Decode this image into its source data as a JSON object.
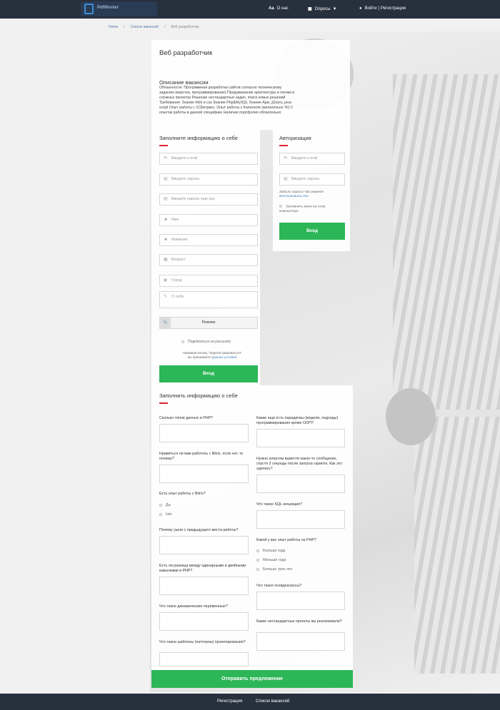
{
  "header": {
    "logo_text": "PdfWorker",
    "about": "О нас",
    "polls": "Опросы",
    "login": "Войти",
    "separator": "|",
    "register": "Регистрация"
  },
  "breadcrumbs": [
    "Home",
    "Список вакансий",
    "Веб разработчик"
  ],
  "vacancy": {
    "title": "Веб разработчик",
    "desc_heading": "Описание вакансии",
    "desc_text": "Обязанности: Программная разработка сайтов согласно техническому заданию (верстка, программирование) Продумывание архитектуры и логики в сложных проектах Решение нестандартных задач, поиск новых решений Требования: Знание html и css Знание Php&MySQL Знание Ajax, jQuery, java script Опыт работы с 1СБитрикс. Опыт работы с framework (желательно Yii) С опытом работы в данной специфике Наличие портфолио обязательно"
  },
  "register_form": {
    "heading": "Заполните информацию о себе",
    "email": "Введите e-mail",
    "password": "Введите пароль",
    "password_repeat": "Введите пароль еще раз",
    "name": "Имя",
    "surname": "Фамилия",
    "age": "Возраст",
    "city": "Город",
    "about": "О себе",
    "resume": "Резюме",
    "subscribe": "Подписаться на рассылку",
    "agree_text": "Нажимая кнопку \"Зарегистрироваться\"",
    "agree_text2": "вы принимаете",
    "agree_link": "данные условия",
    "submit": "Вход"
  },
  "auth_form": {
    "heading": "Авторизация",
    "email": "Введите e-mail",
    "password": "Введите пароль",
    "forgot": "Забыли пароль? Вы можете",
    "restore": "восстановить его",
    "remember": "Запомнить меня на этом компьютере",
    "submit": "Вход"
  },
  "questionnaire": {
    "heading": "Заполнить информацию о себе",
    "q1": "Сколько типов данных в PHP?",
    "q2": "Нравиться ли вам работать с Bitrix, если нет, то почему?",
    "q3": "Есть опыт работы с Bitrix?",
    "q3_yes": "Да",
    "q3_no": "Нет",
    "q4": "Почему ушли с предыдущего места работы?",
    "q5": "Есть ли разница между одинарными и двойными кавычками в PHP?",
    "q6": "Что такое динамические переменные?",
    "q7": "Что такое шаблоны (паттерны) проектирования?",
    "q8": "Какие еще есть парадигмы (модели, подходы) программирования кроме ООП?",
    "q9": "Нужно алертом вывести какое-то сообщение, спустя 3 секунды после запуска скрипта. Как это сделать?",
    "q10": "Что такое SQL-инъекция?",
    "q11": "Какой у вас опыт работы на PHP?",
    "q11_a": "Больше года",
    "q11_b": "Меньше года",
    "q11_c": "Больше трех лет",
    "q12": "Что такое псевдоклассы?",
    "q13": "Какие нестандартные проекты вы реализовали?",
    "submit": "Отправить предложение"
  },
  "footer": {
    "register": "Регистрация",
    "vacancies": "Список вакансий"
  }
}
